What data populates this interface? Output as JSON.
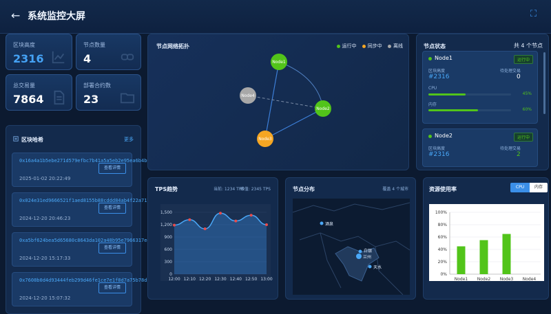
{
  "header": {
    "title": "系统监控大屏",
    "back_icon": "arrow-left-icon",
    "fullscreen_icon": "fullscreen-icon"
  },
  "stats": [
    {
      "label": "区块高度",
      "value": "2316",
      "highlight": true
    },
    {
      "label": "节点数量",
      "value": "4",
      "highlight": false
    },
    {
      "label": "总交易量",
      "value": "7864",
      "highlight": false
    },
    {
      "label": "部署合约数",
      "value": "23",
      "highlight": false
    }
  ],
  "blocks": {
    "title": "区块哈希",
    "more": "更多",
    "detail_label": "查看详情",
    "items": [
      {
        "hash": "0x16a4a1b5ebe271d579efbc7b41a5a5eb2e95ea6b4b647...",
        "time": "2025-01-02 20:22:49"
      },
      {
        "hash": "0x024e31ed9666521f1aed8155b88cddd84ab4f22a71703...",
        "time": "2024-12-20 20:46:23"
      },
      {
        "hash": "0xa5bf624bea5d65680c8643da102a48b95e7966317ed5...",
        "time": "2024-12-20 15:17:33"
      },
      {
        "hash": "0x7608b0d4d93444feb299d46fe1ce7e1f8d7a75b78dfc696...",
        "time": "2024-12-20 15:07:32"
      }
    ]
  },
  "topology": {
    "title": "节点网络拓扑",
    "legend": [
      {
        "label": "运行中",
        "color": "#52c41a"
      },
      {
        "label": "同步中",
        "color": "#f5a623"
      },
      {
        "label": "离线",
        "color": "#a8a8a8"
      }
    ],
    "nodes": [
      {
        "name": "Node1",
        "status": "运行中",
        "color": "#52c41a"
      },
      {
        "name": "Node2",
        "status": "运行中",
        "color": "#52c41a"
      },
      {
        "name": "Node3",
        "status": "同步中",
        "color": "#f5a623"
      },
      {
        "name": "Node4",
        "status": "离线",
        "color": "#a8a8a8"
      }
    ]
  },
  "node_status": {
    "title": "节点状态",
    "total": "共 4 个节点",
    "cards": [
      {
        "name": "Node1",
        "tag": "运行中",
        "height_label": "区块高度",
        "height": "#2316",
        "pending_label": "待处理交易",
        "pending": "0",
        "cpu_label": "CPU",
        "cpu": "45%",
        "cpu_value": 0.45,
        "mem_label": "内存",
        "mem": "60%",
        "mem_value": 0.6
      },
      {
        "name": "Node2",
        "tag": "运行中",
        "height_label": "区块高度",
        "height": "#2316",
        "pending_label": "待处理交易",
        "pending": "2"
      }
    ]
  },
  "tps": {
    "title": "TPS趋势",
    "current": "当前: 1234 TPS",
    "peak": "峰值: 2345 TPS",
    "chart_data": {
      "type": "area",
      "x": [
        "12:00",
        "12:10",
        "12:20",
        "12:30",
        "12:40",
        "12:50",
        "13:00"
      ],
      "values": [
        1190,
        1320,
        1100,
        1480,
        1290,
        1430,
        1200
      ],
      "ylim": [
        0,
        1500
      ],
      "yticks": [
        0,
        300,
        600,
        900,
        1200,
        1500
      ],
      "ytick_labels": [
        "0",
        "300",
        "600",
        "900",
        "1,200",
        "1,500"
      ],
      "color": "#3d8fe8"
    }
  },
  "map": {
    "title": "节点分布",
    "coverage": "覆盖 4 个城市",
    "cities": [
      "酒泉",
      "白银",
      "兰州",
      "天水"
    ]
  },
  "resource": {
    "title": "资源使用率",
    "tabs": [
      "CPU",
      "内存"
    ],
    "active_tab": "CPU",
    "chart_data": {
      "type": "bar",
      "categories": [
        "Node1",
        "Node2",
        "Node3",
        "Node4"
      ],
      "values": [
        45,
        55,
        65,
        0
      ],
      "ylim": [
        0,
        100
      ],
      "yticks": [
        "0%",
        "20%",
        "40%",
        "60%",
        "80%",
        "100%"
      ],
      "color": "#52c41a"
    }
  }
}
